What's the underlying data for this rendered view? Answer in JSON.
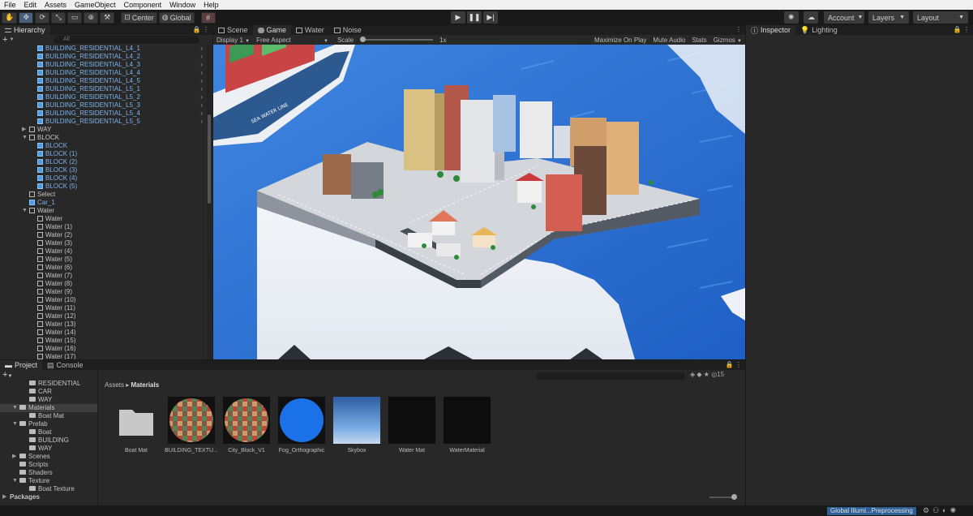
{
  "menubar": [
    "File",
    "Edit",
    "Assets",
    "GameObject",
    "Component",
    "Window",
    "Help"
  ],
  "toolbar": {
    "center_label": "Center",
    "global_label": "Global",
    "account_label": "Account",
    "layers_label": "Layers",
    "layout_label": "Layout"
  },
  "hierarchy": {
    "tab": "Hierarchy",
    "search_placeholder": "All",
    "rows": [
      {
        "label": "BUILDING_RESIDENTIAL_L4_1",
        "indent": 2,
        "prefab": true,
        "child": true
      },
      {
        "label": "BUILDING_RESIDENTIAL_L4_2",
        "indent": 2,
        "prefab": true,
        "child": true
      },
      {
        "label": "BUILDING_RESIDENTIAL_L4_3",
        "indent": 2,
        "prefab": true,
        "child": true
      },
      {
        "label": "BUILDING_RESIDENTIAL_L4_4",
        "indent": 2,
        "prefab": true,
        "child": true
      },
      {
        "label": "BUILDING_RESIDENTIAL_L4_5",
        "indent": 2,
        "prefab": true,
        "child": true
      },
      {
        "label": "BUILDING_RESIDENTIAL_L5_1",
        "indent": 2,
        "prefab": true,
        "child": true
      },
      {
        "label": "BUILDING_RESIDENTIAL_L5_2",
        "indent": 2,
        "prefab": true,
        "child": true
      },
      {
        "label": "BUILDING_RESIDENTIAL_L5_3",
        "indent": 2,
        "prefab": true,
        "child": true
      },
      {
        "label": "BUILDING_RESIDENTIAL_L5_4",
        "indent": 2,
        "prefab": true,
        "child": true
      },
      {
        "label": "BUILDING_RESIDENTIAL_L5_5",
        "indent": 2,
        "prefab": true,
        "child": true
      },
      {
        "label": "WAY",
        "indent": 1,
        "prefab": false,
        "arrow": "closed"
      },
      {
        "label": "BLOCK",
        "indent": 1,
        "prefab": false,
        "arrow": "open"
      },
      {
        "label": "BLOCK",
        "indent": 2,
        "prefab": true
      },
      {
        "label": "BLOCK (1)",
        "indent": 2,
        "prefab": true
      },
      {
        "label": "BLOCK (2)",
        "indent": 2,
        "prefab": true
      },
      {
        "label": "BLOCK (3)",
        "indent": 2,
        "prefab": true
      },
      {
        "label": "BLOCK (4)",
        "indent": 2,
        "prefab": true
      },
      {
        "label": "BLOCK (5)",
        "indent": 2,
        "prefab": true
      },
      {
        "label": "Select",
        "indent": 1,
        "prefab": false
      },
      {
        "label": "Car_1",
        "indent": 1,
        "prefab": true
      },
      {
        "label": "Water",
        "indent": 1,
        "prefab": false,
        "arrow": "open"
      },
      {
        "label": "Water",
        "indent": 2,
        "prefab": false
      },
      {
        "label": "Water (1)",
        "indent": 2,
        "prefab": false
      },
      {
        "label": "Water (2)",
        "indent": 2,
        "prefab": false
      },
      {
        "label": "Water (3)",
        "indent": 2,
        "prefab": false
      },
      {
        "label": "Water (4)",
        "indent": 2,
        "prefab": false
      },
      {
        "label": "Water (5)",
        "indent": 2,
        "prefab": false
      },
      {
        "label": "Water (6)",
        "indent": 2,
        "prefab": false
      },
      {
        "label": "Water (7)",
        "indent": 2,
        "prefab": false
      },
      {
        "label": "Water (8)",
        "indent": 2,
        "prefab": false
      },
      {
        "label": "Water (9)",
        "indent": 2,
        "prefab": false
      },
      {
        "label": "Water (10)",
        "indent": 2,
        "prefab": false
      },
      {
        "label": "Water (11)",
        "indent": 2,
        "prefab": false
      },
      {
        "label": "Water (12)",
        "indent": 2,
        "prefab": false
      },
      {
        "label": "Water (13)",
        "indent": 2,
        "prefab": false
      },
      {
        "label": "Water (14)",
        "indent": 2,
        "prefab": false
      },
      {
        "label": "Water (15)",
        "indent": 2,
        "prefab": false
      },
      {
        "label": "Water (16)",
        "indent": 2,
        "prefab": false
      },
      {
        "label": "Water (17)",
        "indent": 2,
        "prefab": false
      }
    ]
  },
  "center_tabs": {
    "scene": "Scene",
    "game": "Game",
    "water": "Water",
    "noise": "Noise"
  },
  "game_bar": {
    "display": "Display 1",
    "aspect": "Free Aspect",
    "scale_label": "Scale",
    "scale_value": "1x",
    "maximize": "Maximize On Play",
    "mute": "Mute Audio",
    "stats": "Stats",
    "gizmos": "Gizmos"
  },
  "scene_text": {
    "ship_name": "SEA WATER LINE"
  },
  "inspector": {
    "tab": "Inspector",
    "lighting_tab": "Lighting"
  },
  "project": {
    "tab": "Project",
    "console_tab": "Console",
    "breadcrumb_root": "Assets",
    "breadcrumb_current": "Materials",
    "hidden_count": "15",
    "tree": [
      {
        "label": "RESIDENTIAL",
        "indent": 2
      },
      {
        "label": "CAR",
        "indent": 2
      },
      {
        "label": "WAY",
        "indent": 2
      },
      {
        "label": "Materials",
        "indent": 1,
        "arrow": "open",
        "selected": true
      },
      {
        "label": "Boat Mat",
        "indent": 2
      },
      {
        "label": "Prefab",
        "indent": 1,
        "arrow": "open"
      },
      {
        "label": "Boat",
        "indent": 2
      },
      {
        "label": "BUILDING",
        "indent": 2
      },
      {
        "label": "WAY",
        "indent": 2
      },
      {
        "label": "Scenes",
        "indent": 1,
        "arrow": "closed"
      },
      {
        "label": "Scripts",
        "indent": 1
      },
      {
        "label": "Shaders",
        "indent": 1
      },
      {
        "label": "Texture",
        "indent": 1,
        "arrow": "open"
      },
      {
        "label": "Boat Texture",
        "indent": 2
      },
      {
        "label": "Packages",
        "indent": 0,
        "arrow": "closed",
        "bold": true
      }
    ],
    "assets": [
      {
        "label": "Boat Mat",
        "kind": "folder"
      },
      {
        "label": "BUILDING_TEXTU...",
        "kind": "checker"
      },
      {
        "label": "City_Block_V1",
        "kind": "checker"
      },
      {
        "label": "Fog_Orthographic",
        "kind": "blue-sphere"
      },
      {
        "label": "Skybox",
        "kind": "skybox"
      },
      {
        "label": "Water Mat",
        "kind": "black"
      },
      {
        "label": "WaterMaterial",
        "kind": "black"
      }
    ]
  },
  "status": {
    "gi": "Global Illumi...Preprocessing"
  },
  "colors": {
    "accent": "#46607c",
    "water": "#2f6fce",
    "prefab_blue": "#7db3ec"
  }
}
